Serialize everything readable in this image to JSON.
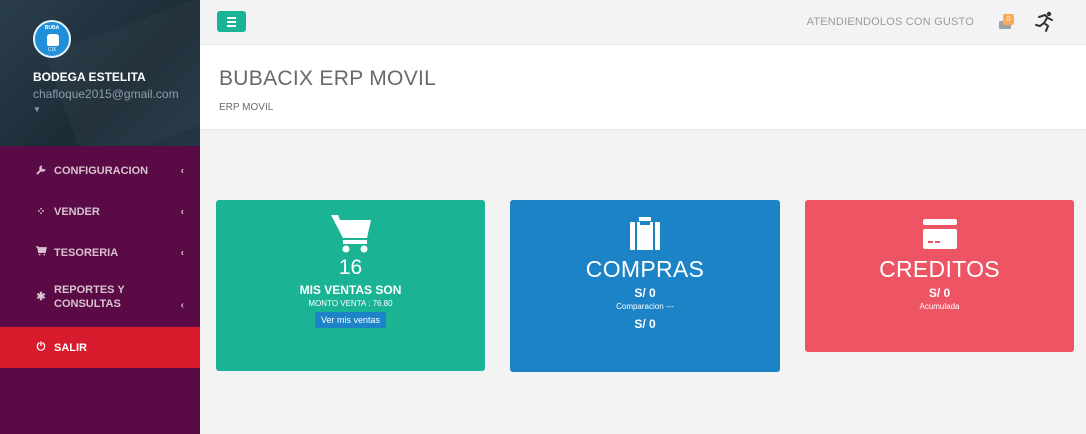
{
  "profile": {
    "avatar_text_top": "BUBA",
    "avatar_text_bottom": "CIX",
    "name": "BODEGA ESTELITA",
    "email": "chafloque2015@gmail.com"
  },
  "sidebar": {
    "items": [
      {
        "label": "CONFIGURACION",
        "icon": "wrench-icon"
      },
      {
        "label": "VENDER",
        "icon": "spinner-icon"
      },
      {
        "label": "TESORERIA",
        "icon": "cart-icon"
      },
      {
        "label": "REPORTES Y CONSULTAS",
        "icon": "gear-icon"
      },
      {
        "label": "SALIR",
        "icon": "power-icon"
      }
    ]
  },
  "topbar": {
    "welcome": "ATENDIENDOLOS CON GUSTO",
    "mail_badge": "0"
  },
  "heading": {
    "title": "BUBACIX ERP MOVIL",
    "subtitle": "ERP MOVIL"
  },
  "cards": {
    "sales": {
      "count": "16",
      "label": "MIS VENTAS SON",
      "amount": "MONTO VENTA : 76.80",
      "button": "Ver mis ventas"
    },
    "purchases": {
      "title": "COMPRAS",
      "value1": "S/ 0",
      "caption": "Comparacion ---",
      "value2": "S/ 0"
    },
    "credits": {
      "title": "CREDITOS",
      "value": "S/ 0",
      "caption": "Acumulada"
    }
  },
  "colors": {
    "sidebar": "#5a0a45",
    "green": "#1ab394",
    "blue": "#1c84c6",
    "red": "#ed5565",
    "salir": "#d81a2d"
  }
}
